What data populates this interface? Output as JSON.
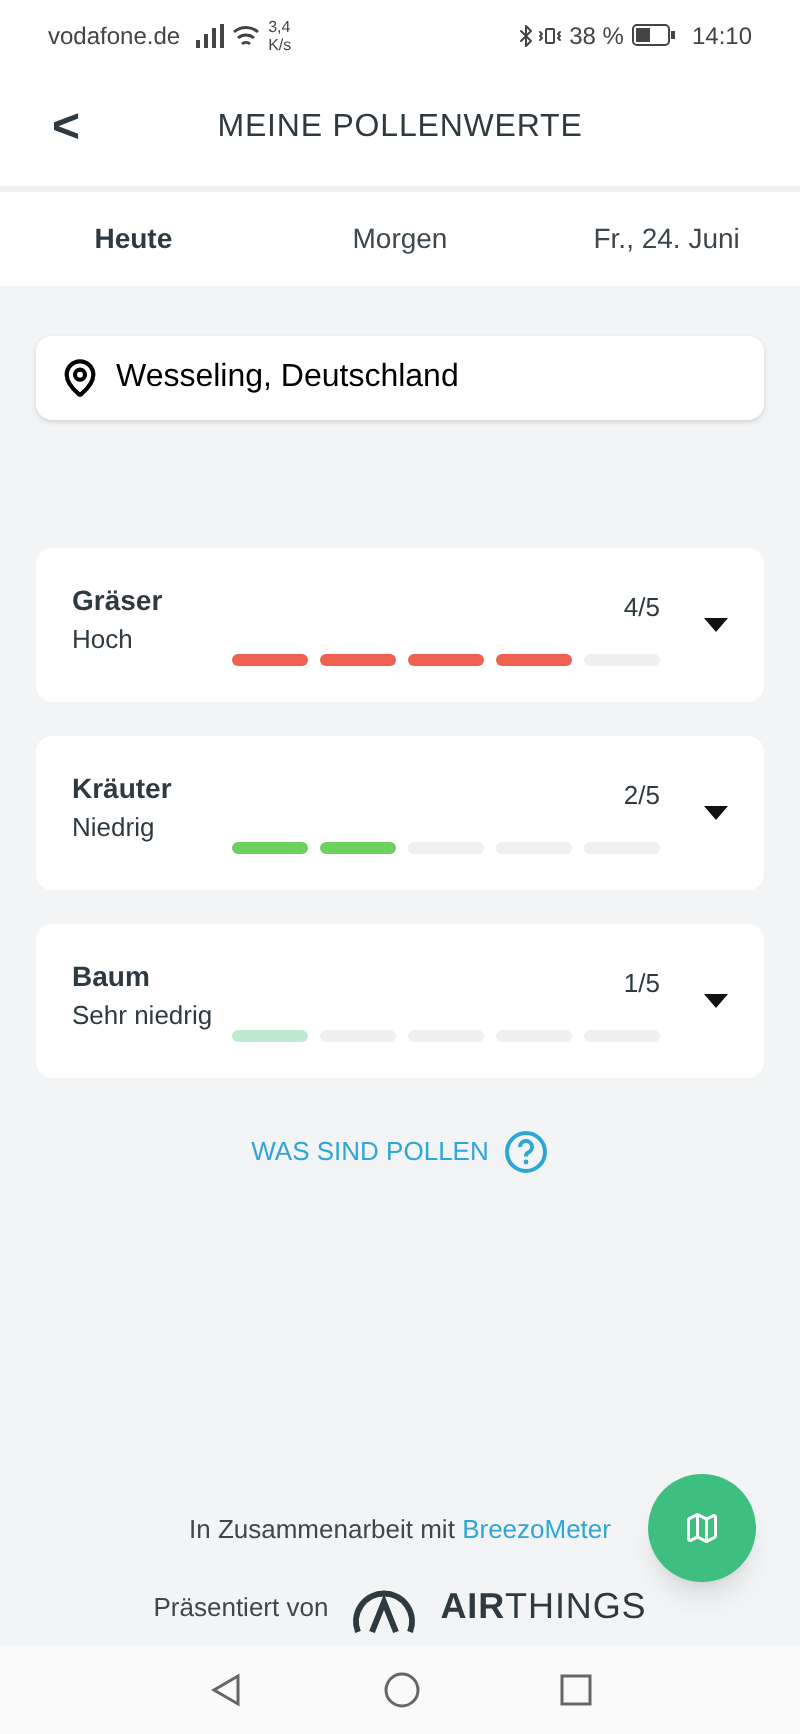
{
  "status_bar": {
    "carrier": "vodafone.de",
    "speed": "3,4",
    "speed_unit": "K/s",
    "battery": "38 %",
    "time": "14:10"
  },
  "header": {
    "back": "<",
    "title": "MEINE POLLENWERTE"
  },
  "tabs": [
    {
      "label": "Heute",
      "selected": true
    },
    {
      "label": "Morgen",
      "selected": false
    },
    {
      "label": "Fr., 24. Juni",
      "selected": false
    }
  ],
  "location": {
    "value": "Wesseling, Deutschland"
  },
  "pollen": [
    {
      "name": "Gräser",
      "rating": "Hoch",
      "score": "4/5",
      "level": 0.8,
      "color": "#f06050"
    },
    {
      "name": "Kräuter",
      "rating": "Niedrig",
      "score": "2/5",
      "level": 0.4,
      "color": "#6dd160"
    },
    {
      "name": "Baum",
      "rating": "Sehr niedrig",
      "score": "1/5",
      "level": 0.2,
      "color": "#bfe9d0"
    }
  ],
  "info_link": "WAS SIND POLLEN",
  "footer": {
    "partner_text": "In Zusammenarbeit mit",
    "partner_link": "BreezoMeter",
    "presented_text": "Präsentiert von",
    "brand": "**AIR**THINGS"
  }
}
